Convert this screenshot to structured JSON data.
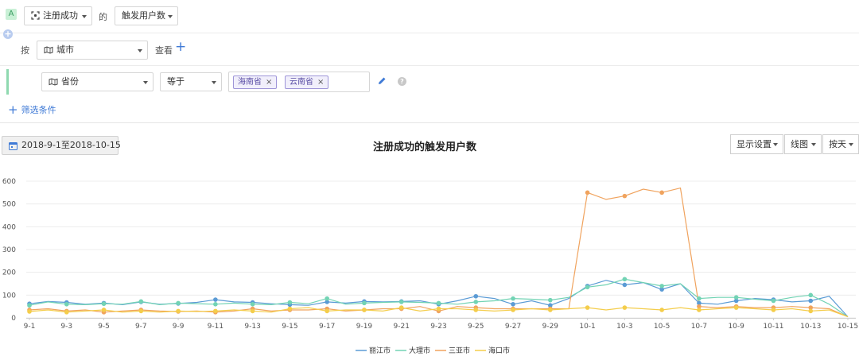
{
  "query": {
    "badge": "A",
    "event": "注册成功",
    "connector": "的",
    "metric": "触发用户数"
  },
  "groupby": {
    "prefix": "按",
    "field": "城市",
    "suffix": "查看",
    "add_symbol": "+"
  },
  "filter": {
    "field": "省份",
    "operator": "等于",
    "values": [
      "海南省",
      "云南省"
    ],
    "remove_symbol": "×",
    "add_label": "筛选条件",
    "add_symbol": "+",
    "help_symbol": "?"
  },
  "toolbar": {
    "date_range": "2018-9-1至2018-10-15",
    "display_settings": "显示设置",
    "chart_type": "线图",
    "granularity": "按天"
  },
  "colors": {
    "accent": "#3f7ad6",
    "lijiang": "#5b9bd5",
    "dali": "#72d3b4",
    "sanya": "#f0a35e",
    "haikou": "#f4cd4b"
  },
  "chart_data": {
    "type": "line",
    "title": "注册成功的触发用户数",
    "ylim": [
      0,
      600
    ],
    "yticks": [
      0,
      100,
      200,
      300,
      400,
      500,
      600
    ],
    "x": [
      "9-1",
      "9-2",
      "9-3",
      "9-4",
      "9-5",
      "9-6",
      "9-7",
      "9-8",
      "9-9",
      "9-10",
      "9-11",
      "9-12",
      "9-13",
      "9-14",
      "9-15",
      "9-16",
      "9-17",
      "9-18",
      "9-19",
      "9-20",
      "9-21",
      "9-22",
      "9-23",
      "9-24",
      "9-25",
      "9-26",
      "9-27",
      "9-28",
      "9-29",
      "9-30",
      "10-1",
      "10-2",
      "10-3",
      "10-4",
      "10-5",
      "10-6",
      "10-7",
      "10-8",
      "10-9",
      "10-10",
      "10-11",
      "10-12",
      "10-13",
      "10-14",
      "10-15"
    ],
    "xticks": [
      "9-1",
      "9-3",
      "9-5",
      "9-7",
      "9-9",
      "9-11",
      "9-13",
      "9-15",
      "9-17",
      "9-19",
      "9-21",
      "9-23",
      "9-25",
      "9-27",
      "9-29",
      "10-1",
      "10-3",
      "10-5",
      "10-7",
      "10-9",
      "10-11",
      "10-13",
      "10-15"
    ],
    "grid": true,
    "legend": "bottom",
    "series": [
      {
        "name": "丽江市",
        "color": "#5b9bd5",
        "values": [
          62,
          72,
          68,
          60,
          65,
          58,
          70,
          60,
          63,
          68,
          80,
          70,
          68,
          62,
          58,
          55,
          70,
          65,
          72,
          70,
          72,
          75,
          60,
          75,
          95,
          85,
          60,
          75,
          55,
          85,
          140,
          165,
          145,
          155,
          125,
          150,
          65,
          60,
          75,
          85,
          80,
          70,
          75,
          95,
          5
        ]
      },
      {
        "name": "大理市",
        "color": "#72d3b4",
        "values": [
          55,
          70,
          60,
          58,
          62,
          60,
          72,
          58,
          65,
          62,
          60,
          65,
          60,
          58,
          68,
          62,
          85,
          60,
          65,
          68,
          70,
          68,
          65,
          60,
          70,
          75,
          85,
          82,
          78,
          90,
          135,
          145,
          170,
          155,
          140,
          150,
          85,
          90,
          90,
          82,
          75,
          90,
          100,
          60,
          5
        ]
      },
      {
        "name": "三亚市",
        "color": "#f0a35e",
        "values": [
          35,
          40,
          30,
          35,
          25,
          30,
          35,
          30,
          28,
          30,
          25,
          30,
          40,
          30,
          35,
          35,
          40,
          30,
          35,
          40,
          40,
          50,
          30,
          50,
          45,
          40,
          40,
          40,
          40,
          40,
          550,
          520,
          535,
          565,
          550,
          570,
          50,
          45,
          50,
          45,
          45,
          50,
          45,
          40,
          5
        ]
      },
      {
        "name": "海口市",
        "color": "#f4cd4b",
        "values": [
          28,
          35,
          25,
          30,
          35,
          25,
          30,
          25,
          30,
          28,
          30,
          35,
          30,
          25,
          40,
          45,
          30,
          35,
          35,
          30,
          45,
          30,
          40,
          40,
          35,
          30,
          35,
          40,
          35,
          40,
          45,
          35,
          45,
          40,
          35,
          45,
          35,
          40,
          45,
          40,
          35,
          40,
          30,
          35,
          5
        ]
      }
    ],
    "markers": [
      {
        "series": 0,
        "indices": [
          0,
          2,
          4,
          6,
          8,
          10,
          12,
          14,
          16,
          18,
          20,
          22,
          24,
          26,
          28,
          30,
          32,
          34,
          36,
          38,
          40,
          42
        ]
      },
      {
        "series": 1,
        "indices": [
          0,
          2,
          4,
          6,
          8,
          10,
          12,
          14,
          16,
          18,
          20,
          22,
          24,
          26,
          28,
          30,
          32,
          34,
          36,
          38,
          40,
          42
        ]
      },
      {
        "series": 2,
        "indices": [
          0,
          2,
          4,
          6,
          8,
          10,
          12,
          14,
          16,
          18,
          20,
          22,
          24,
          26,
          28,
          30,
          32,
          34,
          36,
          38,
          40,
          42
        ]
      },
      {
        "series": 3,
        "indices": [
          0,
          2,
          4,
          6,
          8,
          10,
          12,
          14,
          16,
          18,
          20,
          22,
          24,
          26,
          28,
          30,
          32,
          34,
          36,
          38,
          40,
          42
        ]
      }
    ]
  }
}
